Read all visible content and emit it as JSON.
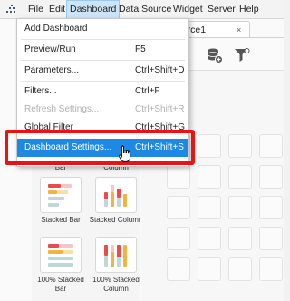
{
  "menubar": {
    "items": [
      {
        "label": "File"
      },
      {
        "label": "Edit"
      },
      {
        "label": "Dashboard"
      },
      {
        "label": "Data Source"
      },
      {
        "label": "Widget"
      },
      {
        "label": "Server"
      },
      {
        "label": "Help"
      }
    ],
    "active_index": 2
  },
  "tab": {
    "label": "ource1",
    "close": "×"
  },
  "dashboard_menu": {
    "items": [
      {
        "label": "Add Dashboard",
        "shortcut": "",
        "disabled": false
      },
      {
        "label": "Preview/Run",
        "shortcut": "F5",
        "disabled": false
      },
      {
        "label": "Parameters...",
        "shortcut": "Ctrl+Shift+D",
        "disabled": false
      },
      {
        "label": "Filters...",
        "shortcut": "Ctrl+F",
        "disabled": false
      },
      {
        "label": "Refresh Settings...",
        "shortcut": "Ctrl+Shift+R",
        "disabled": true
      },
      {
        "label": "Global Filter",
        "shortcut": "Ctrl+Shift+G",
        "disabled": false
      },
      {
        "label": "Dashboard Settings...",
        "shortcut": "Ctrl+Shift+S",
        "disabled": false,
        "selected": true
      }
    ]
  },
  "chart_palette": {
    "partial_top": [
      {
        "label": "Bar"
      },
      {
        "label": "Column"
      }
    ],
    "tiles": [
      {
        "label": "Stacked Bar"
      },
      {
        "label": "Stacked Column"
      },
      {
        "label": "100% Stacked Bar"
      },
      {
        "label": "100% Stacked Column"
      }
    ]
  },
  "toolbar": {
    "icons": [
      "database-add-icon",
      "filter-icon"
    ]
  },
  "colors": {
    "accent_red": "#e84c4c",
    "accent_yellow": "#f3b33d",
    "accent_teal": "#bfd7d9",
    "selection_blue": "#1e88e5",
    "highlight_red": "#ee1111"
  }
}
